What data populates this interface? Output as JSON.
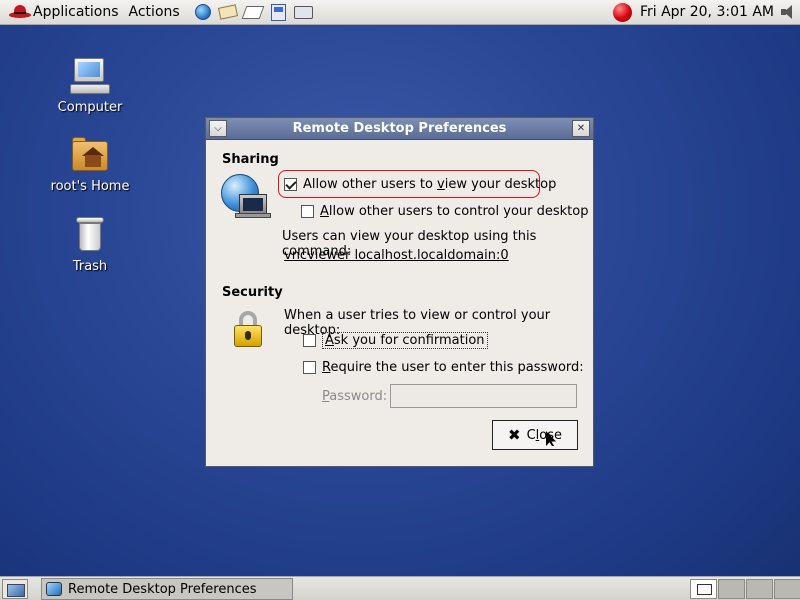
{
  "top_panel": {
    "menus": [
      "Applications",
      "Actions"
    ],
    "clock": "Fri Apr 20,  3:01 AM",
    "launchers": [
      "web-browser-icon",
      "email-icon",
      "writer-icon",
      "calc-icon",
      "presentation-icon"
    ]
  },
  "desktop": {
    "icons": [
      {
        "label": "Computer",
        "icon": "computer-icon"
      },
      {
        "label": "root's Home",
        "icon": "home-folder-icon"
      },
      {
        "label": "Trash",
        "icon": "trash-icon"
      }
    ]
  },
  "dialog": {
    "title": "Remote Desktop Preferences",
    "sharing": {
      "heading": "Sharing",
      "allow_view": {
        "label_pre": "Allow other users to ",
        "label_u": "v",
        "label_post": "iew your desktop",
        "checked": true
      },
      "allow_control": {
        "label_u": "A",
        "label_post": "llow other users to control your desktop",
        "checked": false
      },
      "command_text": "Users can view your desktop using this command:",
      "command_link": "vncviewer localhost.localdomain:0"
    },
    "security": {
      "heading": "Security",
      "intro": "When a user tries to view or control your desktop:",
      "ask_confirm": {
        "label_pre": "",
        "label_u": "A",
        "label_post": "sk you for confirmation",
        "checked": false
      },
      "require_password": {
        "label_u": "R",
        "label_post": "equire the user to enter this password:",
        "checked": false
      },
      "password_label_u": "P",
      "password_label_post": "assword:",
      "password_value": ""
    },
    "close_button": {
      "label_pre": "C",
      "label_u": "l",
      "label_post": "ose"
    }
  },
  "bottom_panel": {
    "task": "Remote Desktop Preferences",
    "workspaces": 4,
    "active_workspace": 1
  },
  "colors": {
    "desktop_bg": "#2a4796",
    "titlebar": "#6b7ca5",
    "highlight_ring": "#e0101a"
  }
}
